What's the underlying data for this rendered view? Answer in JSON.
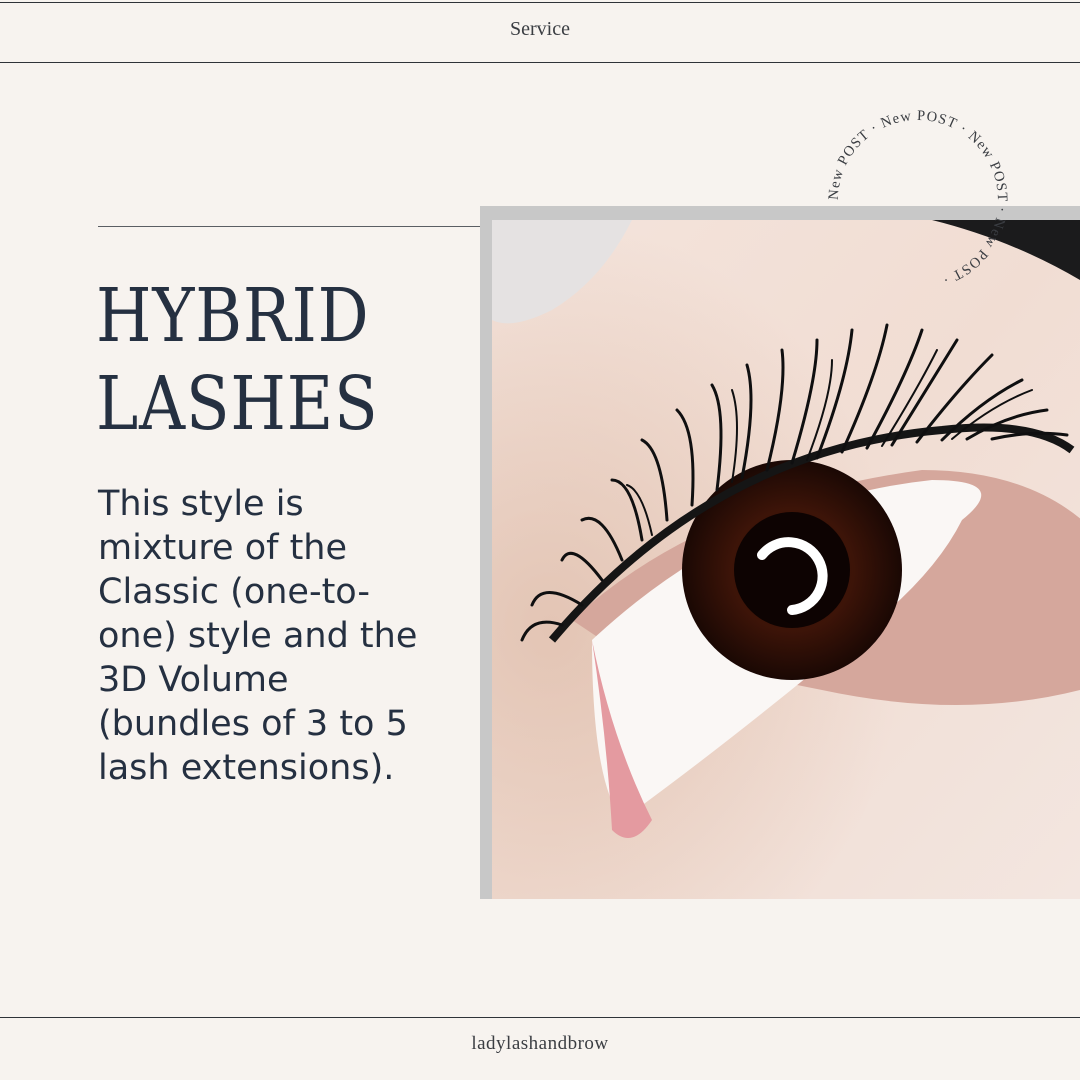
{
  "header": {
    "label": "Service"
  },
  "hero": {
    "title_line1": "HYBRID",
    "title_line2": "LASHES",
    "description": "This style is mixture of the Classic (one-to-one) style and the 3D Volume (bundles of 3 to 5 lash extensions)."
  },
  "badge": {
    "text": "New POST · New POST · New POST · New POST ·"
  },
  "footer": {
    "handle": "ladylashandbrow"
  },
  "colors": {
    "background": "#f7f3ef",
    "text": "#253041",
    "frame": "#c8c8c8"
  }
}
